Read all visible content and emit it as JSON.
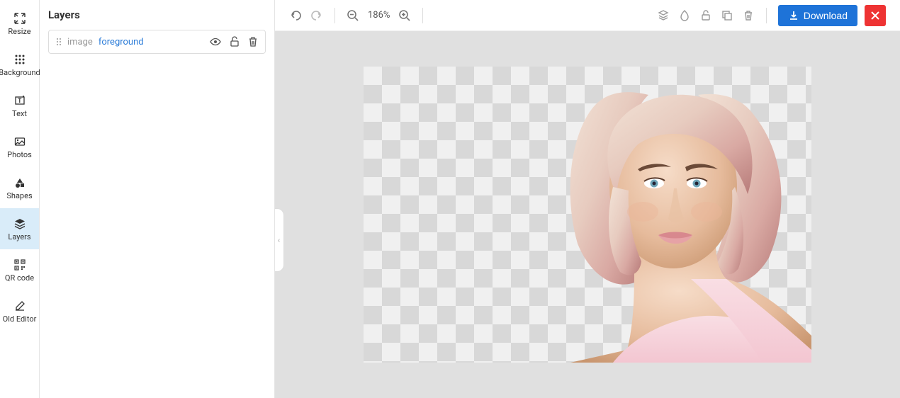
{
  "sidebar": {
    "items": [
      {
        "label": "Resize"
      },
      {
        "label": "Background"
      },
      {
        "label": "Text"
      },
      {
        "label": "Photos"
      },
      {
        "label": "Shapes"
      },
      {
        "label": "Layers"
      },
      {
        "label": "QR code"
      },
      {
        "label": "Old Editor"
      }
    ]
  },
  "panel": {
    "title": "Layers",
    "layer": {
      "type": "image",
      "name": "foreground"
    }
  },
  "toolbar": {
    "zoom": "186%",
    "download": "Download"
  }
}
